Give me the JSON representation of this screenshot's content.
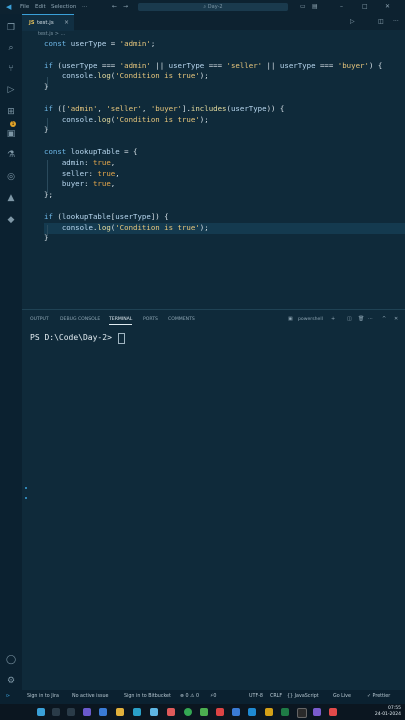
{
  "titlebar": {
    "menu": [
      "File",
      "Edit",
      "Selection",
      "···"
    ],
    "search": "Day-2"
  },
  "tab": {
    "icon": "JS",
    "name": "test.js",
    "close": "×"
  },
  "breadcrumb": "test.js > ...",
  "code": [
    "const userType = 'admin';",
    "",
    "if (userType === 'admin' || userType === 'seller' || userType === 'buyer') {",
    "    console.log('Condition is true');",
    "}",
    "",
    "if (['admin', 'seller', 'buyer'].includes(userType)) {",
    "    console.log('Condition is true');",
    "}",
    "",
    "const lookupTable = {",
    "    admin: true,",
    "    seller: true,",
    "    buyer: true,",
    "};",
    "",
    "if (lookupTable[userType]) {",
    "    console.log('Condition is true');",
    "}"
  ],
  "panel": {
    "tabs": [
      "OUTPUT",
      "DEBUG CONSOLE",
      "TERMINAL",
      "PORTS",
      "COMMENTS"
    ],
    "active_tab": "TERMINAL",
    "shell": "powershell",
    "prompt": "PS D:\\Code\\Day-2>"
  },
  "statusbar": {
    "jira": "Sign in to Jira",
    "issue": "No active issue",
    "bitbucket": "Sign in to Bitbucket",
    "problems": "⊗ 0 ⚠ 0",
    "ports": "⚡0",
    "encoding": "UTF-8",
    "eol": "CRLF",
    "language": "{} JavaScript",
    "live": "Go Live",
    "prettier": "✓ Prettier"
  },
  "badge": "1",
  "clock": {
    "time": "07:55",
    "date": "24-01-2024"
  },
  "colors": {
    "accent": "#3aa0d8",
    "background": "#0f2a3a",
    "badge": "#e0a32a"
  }
}
